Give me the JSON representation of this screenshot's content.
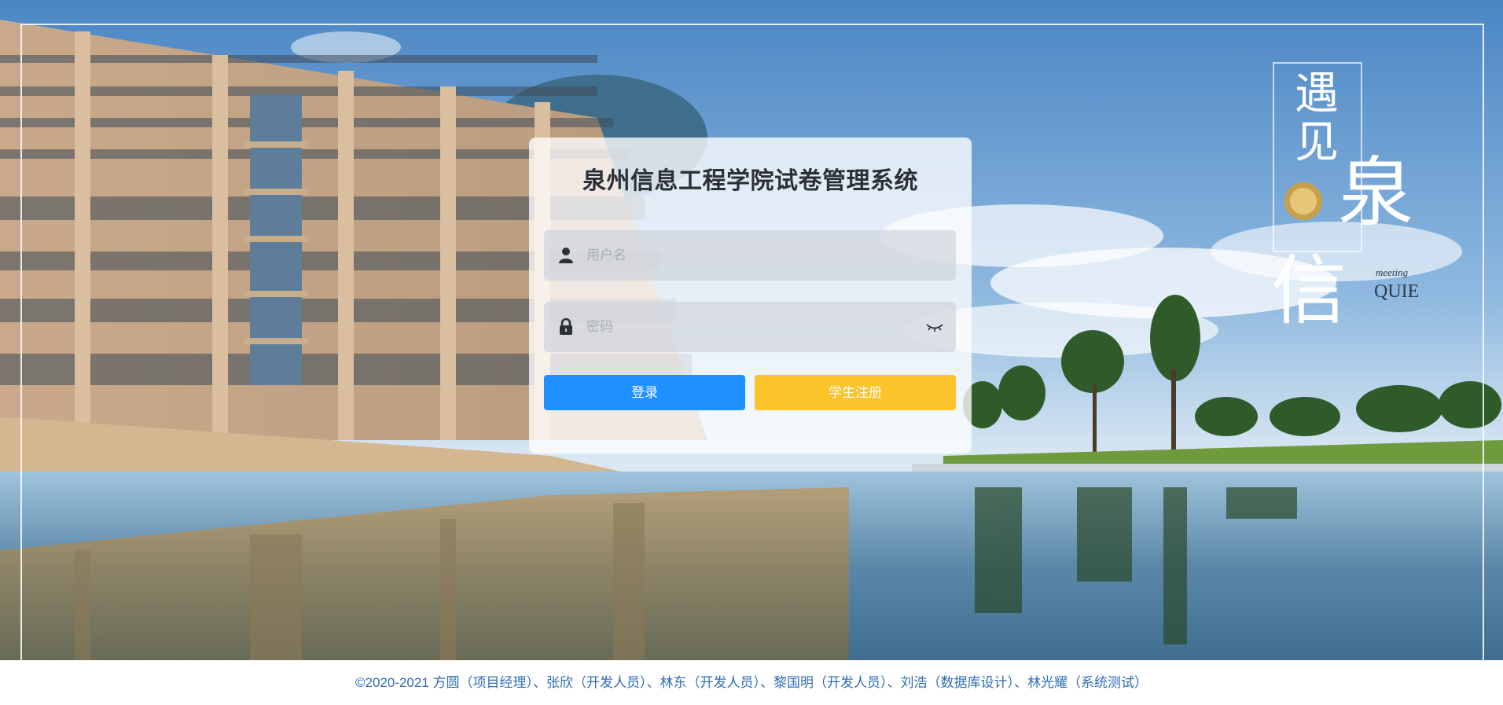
{
  "login": {
    "title": "泉州信息工程学院试卷管理系统",
    "username_placeholder": "用户名",
    "password_placeholder": "密码",
    "login_label": "登录",
    "register_label": "学生注册"
  },
  "logo": {
    "line1": "遇",
    "line2": "见",
    "char_big": "泉",
    "char_side": "信",
    "meeting": "meeting",
    "quie": "QUIE"
  },
  "footer": {
    "text": "©2020-2021 方圆（项目经理）、张欣（开发人员）、林东（开发人员）、黎国明（开发人员）、刘浩（数据库设计）、林光耀（系统测试）"
  },
  "colors": {
    "primary": "#1e90ff",
    "warning": "#fbc42b",
    "footer_text": "#2f6db5"
  }
}
